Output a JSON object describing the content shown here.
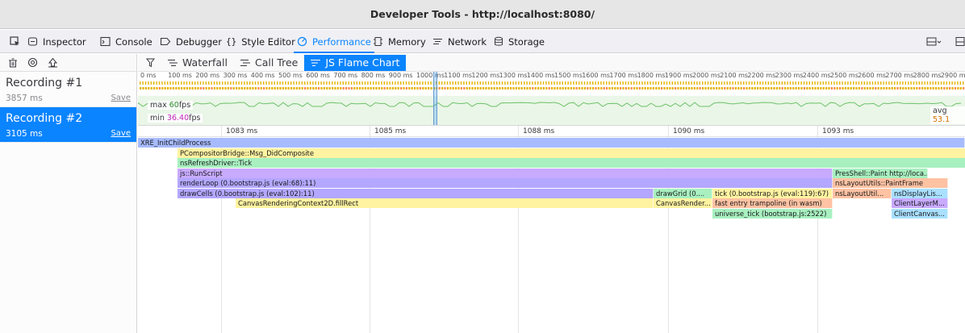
{
  "window": {
    "title": "Developer Tools - http://localhost:8080/"
  },
  "toolbox": {
    "tabs": [
      {
        "label": "Inspector",
        "icon": "inspector-icon"
      },
      {
        "label": "Console",
        "icon": "console-icon"
      },
      {
        "label": "Debugger",
        "icon": "debugger-icon"
      },
      {
        "label": "Style Editor",
        "icon": "style-editor-icon"
      },
      {
        "label": "Performance",
        "icon": "performance-icon"
      },
      {
        "label": "Memory",
        "icon": "memory-icon"
      },
      {
        "label": "Network",
        "icon": "network-icon"
      },
      {
        "label": "Storage",
        "icon": "storage-icon"
      }
    ],
    "selected_tab": "Performance",
    "accent_color": "#0a84ff"
  },
  "sidebar": {
    "toolbar_icons": [
      "trash-icon",
      "record-icon",
      "import-icon"
    ],
    "recordings": [
      {
        "name": "Recording #1",
        "duration": "3857 ms",
        "save": "Save",
        "selected": false
      },
      {
        "name": "Recording #2",
        "duration": "3105 ms",
        "save": "Save",
        "selected": true
      }
    ]
  },
  "views": {
    "filter_icon": "filter-icon",
    "buttons": [
      {
        "label": "Waterfall",
        "icon": "waterfall-icon"
      },
      {
        "label": "Call Tree",
        "icon": "call-tree-icon"
      },
      {
        "label": "JS Flame Chart",
        "icon": "flame-chart-icon"
      }
    ],
    "selected": "JS Flame Chart"
  },
  "overview": {
    "ticks": [
      "0 ms",
      "100 ms",
      "200 ms",
      "300 ms",
      "400 ms",
      "500 ms",
      "600 ms",
      "700 ms",
      "800 ms",
      "900 ms",
      "1000 ms",
      "1100 ms",
      "1200 ms",
      "1300 ms",
      "1400 ms",
      "1500 ms",
      "1600 ms",
      "1700 ms",
      "1800 ms",
      "1900 ms",
      "2000 ms",
      "2100 ms",
      "2200 ms",
      "2300 ms",
      "2400 ms",
      "2500 ms",
      "2600 ms",
      "2700 ms",
      "2800 ms",
      "2900 ms"
    ],
    "fps": {
      "max_label": "max",
      "max_value": "60",
      "max_unit": "fps",
      "min_label": "min",
      "min_value": "36.40",
      "min_unit": "fps",
      "avg_label": "avg",
      "avg_value": "53.1"
    },
    "colors": {
      "fps_fill": "#eaf6e7",
      "fps_line": "#6cc26a",
      "js_markers": "#e5b400",
      "paint_markers": "#ff8a4c"
    }
  },
  "flame": {
    "ruler": [
      "1083 ms",
      "1085 ms",
      "1088 ms",
      "1090 ms",
      "1093 ms"
    ],
    "frames": [
      {
        "label": "XRE_InitChildProcess",
        "color": "#a7bbff"
      },
      {
        "label": "PCompositorBridge::Msg_DidComposite",
        "color": "#fff3a1"
      },
      {
        "label": "nsRefreshDriver::Tick",
        "color": "#a8f0c0"
      },
      {
        "label": "js::RunScript",
        "color": "#c8aaff"
      },
      {
        "label": "PresShell::Paint http://loca...",
        "color": "#a8f0c0"
      },
      {
        "label": "renderLoop (0.bootstrap.js (eval:68):11)",
        "color": "#b3a7ff"
      },
      {
        "label": "nsLayoutUtils::PaintFrame",
        "color": "#ffc2a3"
      },
      {
        "label": "drawCells (0.bootstrap.js (eval:102):11)",
        "color": "#b3a7ff"
      },
      {
        "label": "drawGrid (0....",
        "color": "#a8f0c0"
      },
      {
        "label": "tick (0.bootstrap.js (eval:119):67)",
        "color": "#fff3a1"
      },
      {
        "label": "nsLayoutUtil...",
        "color": "#ffc2a3"
      },
      {
        "label": "nsDisplayLis...",
        "color": "#a9e0ff"
      },
      {
        "label": "CanvasRenderingContext2D.fillRect",
        "color": "#fff3a1"
      },
      {
        "label": "CanvasRender...",
        "color": "#fff3a1"
      },
      {
        "label": "fast entry trampoline (in wasm)",
        "color": "#ffc2a3"
      },
      {
        "label": "ClientLayerM...",
        "color": "#c8aaff"
      },
      {
        "label": "universe_tick (bootstrap.js:2522)",
        "color": "#a8f0c0"
      },
      {
        "label": "ClientCanvas...",
        "color": "#a9e0ff"
      }
    ]
  }
}
